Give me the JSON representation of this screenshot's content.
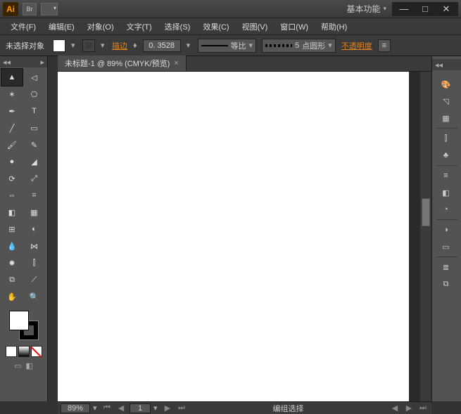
{
  "app": {
    "logo": "Ai",
    "bridge": "Br",
    "workspace_label": "基本功能"
  },
  "window_buttons": {
    "min": "—",
    "max": "□",
    "close": "✕"
  },
  "menu": [
    "文件(F)",
    "编辑(E)",
    "对象(O)",
    "文字(T)",
    "选择(S)",
    "效果(C)",
    "视图(V)",
    "窗口(W)",
    "帮助(H)"
  ],
  "control": {
    "selection_status": "未选择对象",
    "stroke_label": "描边",
    "stroke_weight": "0. 3528",
    "profile": "等比",
    "brush_pt": "5",
    "brush_label": "点圆形",
    "opacity_label": "不透明度"
  },
  "tab": {
    "title": "未标题-1 @ 89% (CMYK/预览)",
    "close": "×"
  },
  "tools": {
    "names": [
      "selection-tool",
      "direct-selection-tool",
      "magic-wand-tool",
      "lasso-tool",
      "pen-tool",
      "type-tool",
      "line-segment-tool",
      "rectangle-tool",
      "paintbrush-tool",
      "pencil-tool",
      "blob-brush-tool",
      "eraser-tool",
      "rotate-tool",
      "scale-tool",
      "width-tool",
      "free-transform-tool",
      "shape-builder-tool",
      "perspective-grid-tool",
      "mesh-tool",
      "gradient-tool",
      "eyedropper-tool",
      "blend-tool",
      "symbol-sprayer-tool",
      "column-graph-tool",
      "artboard-tool",
      "slice-tool",
      "hand-tool",
      "zoom-tool"
    ],
    "glyphs": [
      "▲",
      "◁",
      "✶",
      "⎔",
      "✒",
      "T",
      "╱",
      "▭",
      "🖌",
      "✎",
      "●",
      "◢",
      "⟳",
      "⤢",
      "⇔",
      "⌗",
      "◧",
      "▦",
      "⊞",
      "◐",
      "💧",
      "⋈",
      "✹",
      "⫿",
      "⧉",
      "⟋",
      "✋",
      "🔍"
    ]
  },
  "right_panels": [
    "color-panel",
    "color-guide-panel",
    "swatches-panel",
    "brushes-panel",
    "symbols-panel",
    "stroke-panel",
    "gradient-panel",
    "transparency-panel",
    "appearance-panel",
    "graphic-styles-panel",
    "layers-panel",
    "artboards-panel"
  ],
  "right_glyphs": [
    "🎨",
    "◹",
    "▦",
    "⫿",
    "♣",
    "≡",
    "◧",
    "◔",
    "◑",
    "▭",
    "≣",
    "⧉"
  ],
  "status": {
    "zoom": "89%",
    "artboard": "1",
    "context": "编组选择"
  }
}
